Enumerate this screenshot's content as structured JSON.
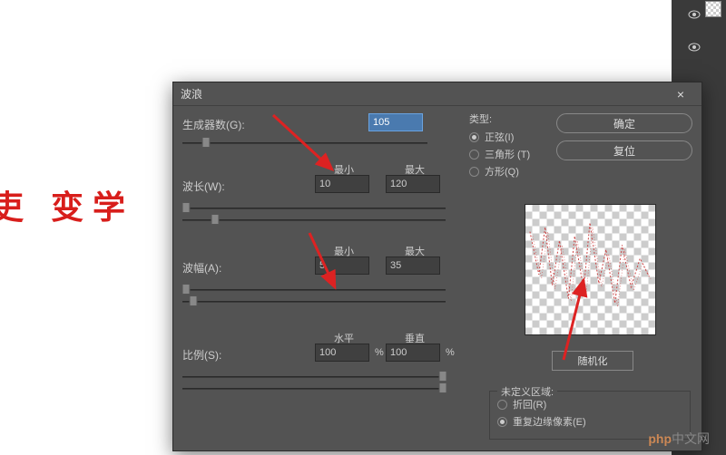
{
  "dialog": {
    "title": "波浪",
    "close": "×",
    "generators": {
      "label": "生成器数(G):",
      "value": "105"
    },
    "wavelength": {
      "label": "波长(W):",
      "min_label": "最小",
      "max_label": "最大",
      "min": "10",
      "max": "120"
    },
    "amplitude": {
      "label": "波幅(A):",
      "min_label": "最小",
      "max_label": "最大",
      "min": "5",
      "max": "35"
    },
    "scale": {
      "label": "比例(S):",
      "h_label": "水平",
      "v_label": "垂直",
      "h": "100",
      "v": "100",
      "pct": "%"
    },
    "type": {
      "label": "类型:",
      "options": [
        {
          "label": "正弦(I)",
          "checked": true
        },
        {
          "label": "三角形 (T)",
          "checked": false
        },
        {
          "label": "方形(Q)",
          "checked": false
        }
      ]
    },
    "ok": "确定",
    "reset": "复位",
    "randomize": "随机化",
    "undefined": {
      "label": "未定义区域:",
      "options": [
        {
          "label": "折回(R)",
          "checked": false
        },
        {
          "label": "重复边缘像素(E)",
          "checked": true
        }
      ]
    }
  },
  "bg_text": "吏  变学",
  "watermark": {
    "php": "php",
    "cn": "中文网"
  }
}
